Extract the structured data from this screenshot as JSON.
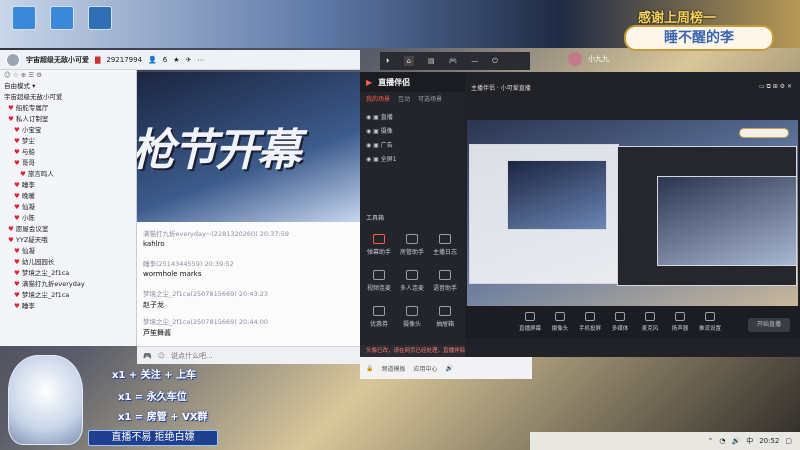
{
  "banner": {
    "top": "感谢上周榜一",
    "name": "睡不醒的李"
  },
  "chat_window": {
    "title": "宇宙超级无敌小可爱",
    "id": "29217994",
    "member_count": "6",
    "filter": "自由模式",
    "tree": [
      "宇宙超级无敌小可爱",
      "船舵专属厅",
      "私人订制室",
      "小宝宝",
      "梦尘",
      "与船",
      "哥哥",
      "旅言鸣人",
      "睡李",
      "晚暖",
      "仙凝",
      "小陈",
      "愿屋会议室",
      "YYZ疑天哦",
      "仙凝",
      "幼儿园园长",
      "梦境之尘_2f1ca",
      "满猫打九折everyday",
      "梦境之尘_2f1ca",
      "睡李"
    ]
  },
  "video": {
    "title": "枪节开幕"
  },
  "messages": [
    {
      "from": "满猫打九折everyday~(2281320260)",
      "time": "20:37:59",
      "body": "kahlro"
    },
    {
      "from": "睡李(2514344559)",
      "time": "20:39:52",
      "body": "wormhole marks"
    },
    {
      "from": "梦境之尘_2f1ca(2507815669)",
      "time": "20:43:23",
      "body": "赵子龙"
    },
    {
      "from": "梦境之尘_2f1ca(2507815669)",
      "time": "20:44:00",
      "body": "芦笙舞酱"
    }
  ],
  "input": {
    "placeholder": "说点什么吧..."
  },
  "live_app": {
    "name": "直播伴侣",
    "tabs": [
      "我的场景",
      "互动",
      "可选场景"
    ],
    "sources": [
      "直播",
      "摄像",
      "广告",
      "全屏1"
    ],
    "tools_label": "工具箱",
    "tools": [
      "弹幕助手",
      "房管助手",
      "主播日志",
      "视频连麦",
      "多人连麦",
      "语音助手",
      "优惠券",
      "摄像头",
      "抽屉箱"
    ],
    "notice": "头像已改，请在网页已经处理，直播伴侣后台、稍后一键操作",
    "footer": [
      "频道模板",
      "应用中心"
    ]
  },
  "preview": {
    "title": "主播伴侣 · 小可爱直播",
    "controls": [
      "直播屏幕",
      "摄像头",
      "手机投屏",
      "多媒体",
      "麦克风",
      "扬声器",
      "推流设置"
    ],
    "start_button": "开始直播"
  },
  "overlay": {
    "line1": "x1 + 关注 + 上车",
    "line2": "x1 = 永久车位",
    "line3": "x1 = 房管 + VX群",
    "badge": "直播不易 拒绝白嫖"
  },
  "taskbar": {
    "time": "20:52",
    "lang": "中"
  },
  "top_bar": {
    "username": "小九九"
  }
}
